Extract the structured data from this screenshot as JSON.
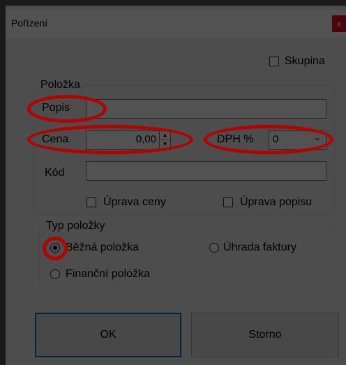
{
  "window": {
    "title": "Pořízení",
    "close_label": "x"
  },
  "top": {
    "skupina_label": "Skupina",
    "skupina_checked": false
  },
  "polozka_group": {
    "title": "Položka",
    "popis_label": "Popis",
    "popis_value": "",
    "cena_label": "Cena",
    "cena_value": "0,00",
    "dph_label": "DPH %",
    "dph_value": "0",
    "kod_label": "Kód",
    "kod_value": "",
    "uprava_ceny_label": "Úprava ceny",
    "uprava_ceny_checked": false,
    "uprava_popisu_label": "Úprava popisu",
    "uprava_popisu_checked": false
  },
  "typ_group": {
    "title": "Typ položky",
    "options": [
      {
        "label": "Běžná položka",
        "checked": true
      },
      {
        "label": "Úhrada faktury",
        "checked": false
      },
      {
        "label": "Finanční položka",
        "checked": false
      }
    ]
  },
  "buttons": {
    "ok_label": "OK",
    "storno_label": "Storno"
  },
  "icons": {
    "spin_up": "▲",
    "spin_down": "▼",
    "dropdown": "⌄"
  },
  "colors": {
    "annotation": "#b40000",
    "default_button_border": "#0078d7",
    "close": "#e81123"
  }
}
